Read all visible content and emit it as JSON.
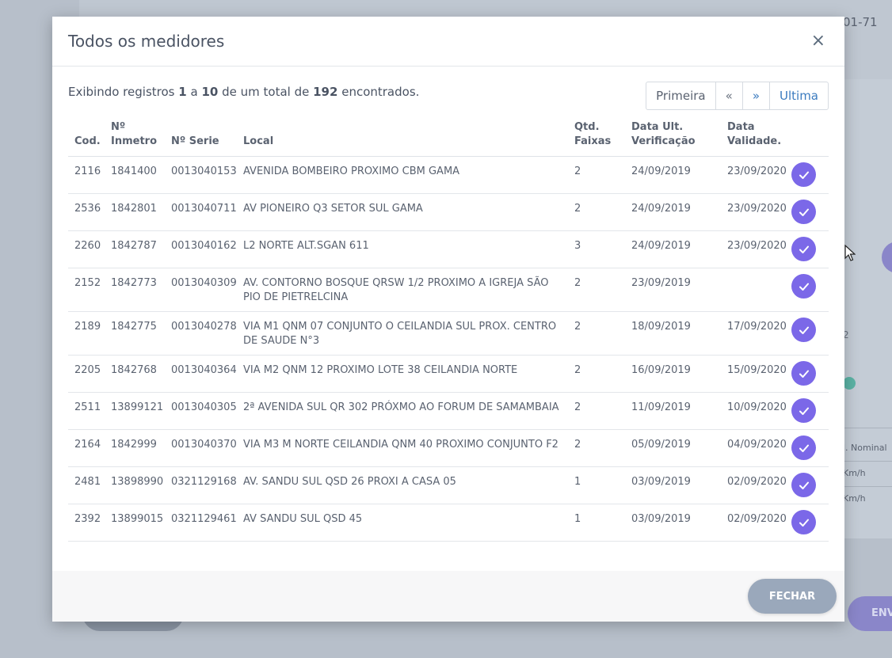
{
  "background": {
    "code_fragment": "01-71",
    "num_fragment": "2",
    "label_nominal": "l. Nominal",
    "label_kmh_1": "Km/h",
    "label_kmh_2": "Km/h",
    "right_button_fragment": "ENV"
  },
  "modal": {
    "title": "Todos os medidores",
    "close_label": "×",
    "summary": {
      "prefix": "Exibindo registros",
      "from": "1",
      "middle": "a",
      "to": "10",
      "total_text": "de um total de",
      "total": "192",
      "suffix": "encontrados."
    },
    "pagination": {
      "first": "Primeira",
      "prev": "«",
      "next": "»",
      "last": "Ultima"
    },
    "table": {
      "headers": {
        "cod": "Cod.",
        "inmetro_1": "Nº",
        "inmetro_2": "Inmetro",
        "serie": "Nº Serie",
        "local": "Local",
        "faixas_1": "Qtd.",
        "faixas_2": "Faixas",
        "verif_1": "Data Ult.",
        "verif_2": "Verificação",
        "valid_1": "Data",
        "valid_2": "Validade."
      },
      "rows": [
        {
          "cod": "2116",
          "inmetro": "1841400",
          "serie": "0013040153",
          "local": "AVENIDA BOMBEIRO PROXIMO CBM GAMA",
          "faixas": "2",
          "verif": "24/09/2019",
          "valid": "23/09/2020"
        },
        {
          "cod": "2536",
          "inmetro": "1842801",
          "serie": "0013040711",
          "local": "AV PIONEIRO Q3 SETOR SUL GAMA",
          "faixas": "2",
          "verif": "24/09/2019",
          "valid": "23/09/2020"
        },
        {
          "cod": "2260",
          "inmetro": "1842787",
          "serie": "0013040162",
          "local": "L2 NORTE ALT.SGAN 611",
          "faixas": "3",
          "verif": "24/09/2019",
          "valid": "23/09/2020"
        },
        {
          "cod": "2152",
          "inmetro": "1842773",
          "serie": "0013040309",
          "local": "AV. CONTORNO BOSQUE QRSW 1/2 PROXIMO A IGREJA SÃO PIO DE PIETRELCINA",
          "faixas": "2",
          "verif": "23/09/2019",
          "valid": ""
        },
        {
          "cod": "2189",
          "inmetro": "1842775",
          "serie": "0013040278",
          "local": "VIA M1 QNM 07 CONJUNTO O CEILANDIA SUL PROX. CENTRO DE SAUDE N°3",
          "faixas": "2",
          "verif": "18/09/2019",
          "valid": "17/09/2020"
        },
        {
          "cod": "2205",
          "inmetro": "1842768",
          "serie": "0013040364",
          "local": "VIA M2 QNM 12 PROXIMO LOTE 38 CEILANDIA NORTE",
          "faixas": "2",
          "verif": "16/09/2019",
          "valid": "15/09/2020"
        },
        {
          "cod": "2511",
          "inmetro": "13899121",
          "serie": "0013040305",
          "local": "2ª AVENIDA SUL QR 302 PRÓXMO AO FORUM DE SAMAMBAIA",
          "faixas": "2",
          "verif": "11/09/2019",
          "valid": "10/09/2020"
        },
        {
          "cod": "2164",
          "inmetro": "1842999",
          "serie": "0013040370",
          "local": "VIA M3 M NORTE CEILANDIA QNM 40 PROXIMO CONJUNTO F2",
          "faixas": "2",
          "verif": "05/09/2019",
          "valid": "04/09/2020"
        },
        {
          "cod": "2481",
          "inmetro": "13898990",
          "serie": "0321129168",
          "local": "AV. SANDU SUL QSD 26 PROXI A CASA 05",
          "faixas": "1",
          "verif": "03/09/2019",
          "valid": "02/09/2020"
        },
        {
          "cod": "2392",
          "inmetro": "13899015",
          "serie": "0321129461",
          "local": "AV SANDU SUL QSD 45",
          "faixas": "1",
          "verif": "03/09/2019",
          "valid": "02/09/2020"
        }
      ]
    },
    "footer": {
      "close_button": "FECHAR"
    }
  },
  "colors": {
    "accent": "#7b68e8",
    "link": "#3b7bbf",
    "footer_button": "#9aa8bb"
  },
  "icons": {
    "select": "check-icon",
    "close": "close-icon",
    "cursor": "mouse-pointer-icon"
  }
}
